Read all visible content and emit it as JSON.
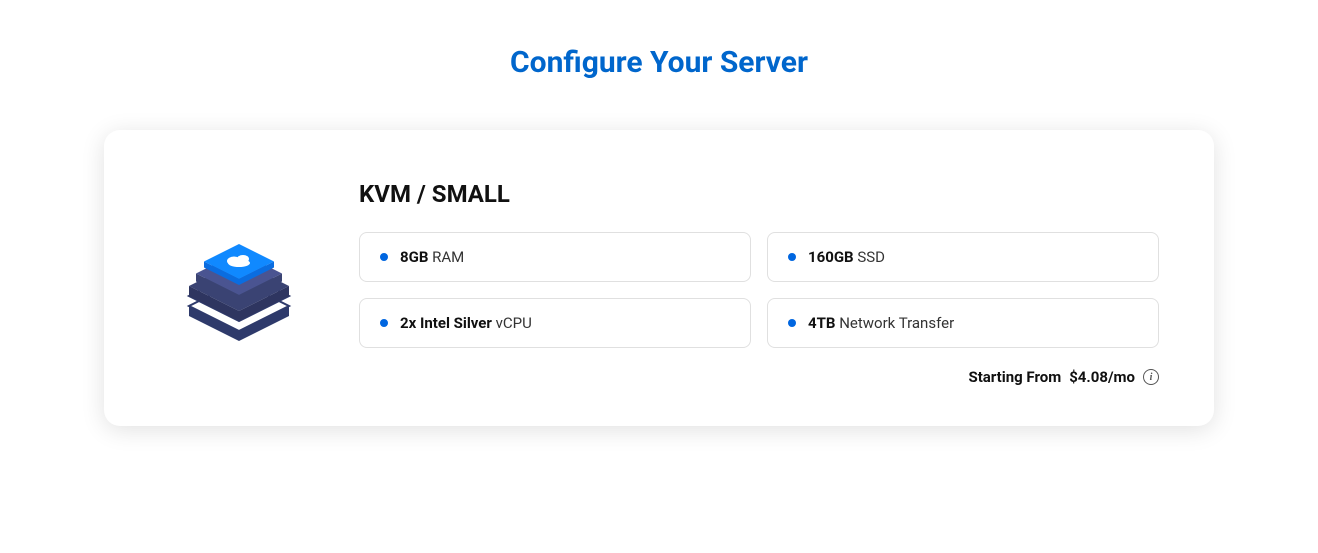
{
  "page_title": "Configure Your Server",
  "plan": {
    "title": "KVM / SMALL",
    "specs": [
      {
        "bold": "8GB",
        "rest": " RAM"
      },
      {
        "bold": "160GB",
        "rest": " SSD"
      },
      {
        "bold": "2x Intel Silver",
        "rest": " vCPU"
      },
      {
        "bold": "4TB",
        "rest": " Network Transfer"
      }
    ],
    "price_label": "Starting From",
    "price_value": "$4.08/mo"
  }
}
